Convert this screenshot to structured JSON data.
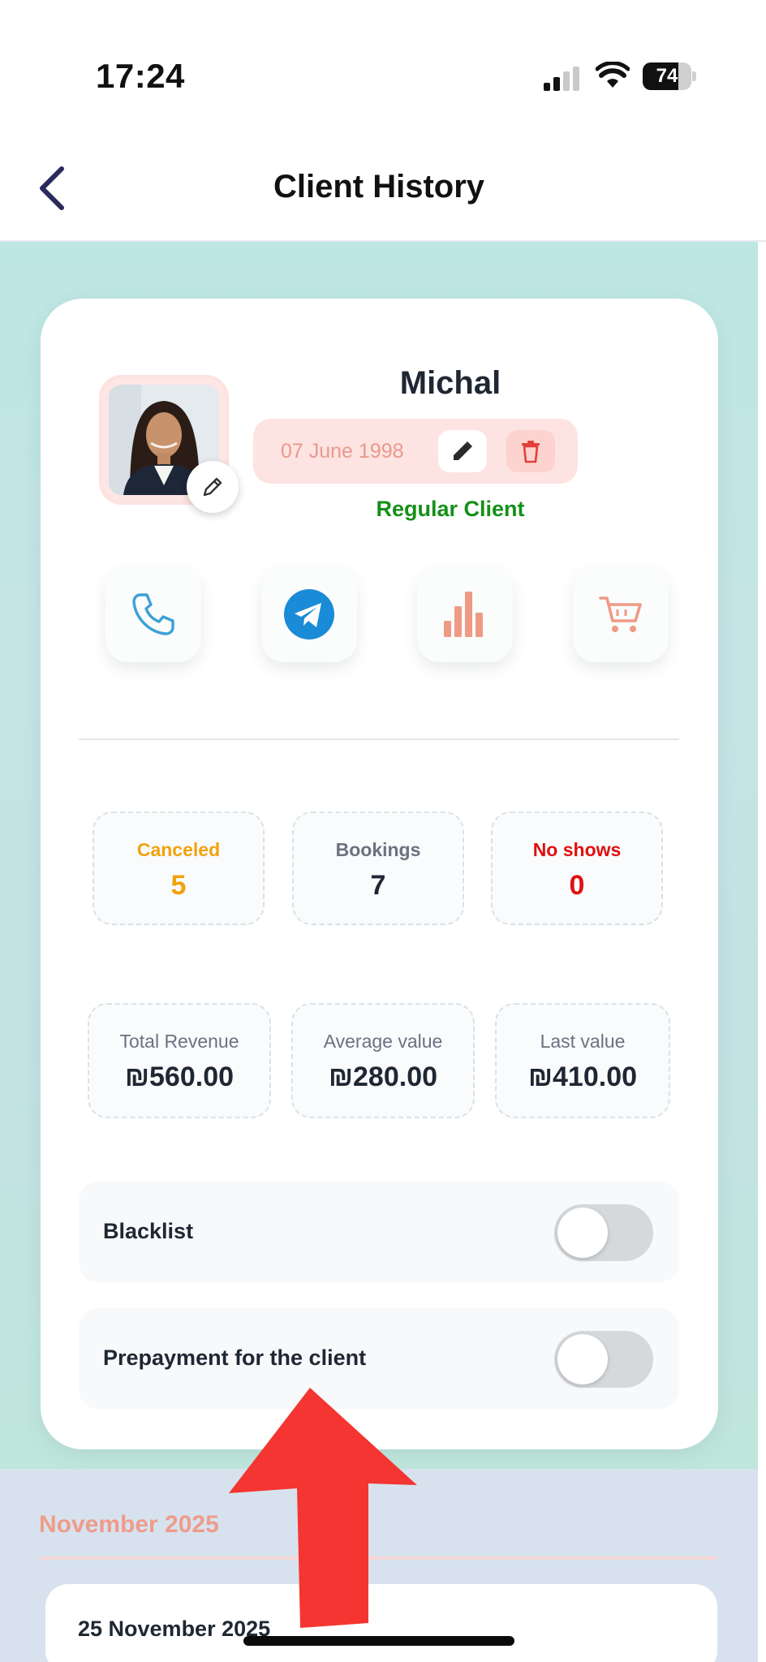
{
  "status_bar": {
    "time": "17:24",
    "battery": "74",
    "battery_level": 0.74
  },
  "nav": {
    "title": "Client History"
  },
  "client": {
    "name": "Michal",
    "birthday": "07 June 1998",
    "type": "Regular Client"
  },
  "actions": [
    {
      "icon": "phone-icon"
    },
    {
      "icon": "telegram-icon"
    },
    {
      "icon": "bar-chart-icon"
    },
    {
      "icon": "cart-icon"
    }
  ],
  "stats": [
    {
      "label": "Canceled",
      "value": "5",
      "color": "#f2a20c"
    },
    {
      "label": "Bookings",
      "value": "7",
      "color": "#1f2733"
    },
    {
      "label": "No shows",
      "value": "0",
      "color": "#e01010"
    }
  ],
  "money": [
    {
      "label": "Total Revenue",
      "value": "₪560.00"
    },
    {
      "label": "Average value",
      "value": "₪280.00"
    },
    {
      "label": "Last value",
      "value": "₪410.00"
    }
  ],
  "toggles": [
    {
      "label": "Blacklist",
      "on": false
    },
    {
      "label": "Prepayment for the client",
      "on": false
    }
  ],
  "history": {
    "month": "November 2025",
    "day": "25 November 2025"
  },
  "colors": {
    "accent_salmon": "#ee9c8c",
    "regular_green": "#149018",
    "telegram_blue": "#1a8bd6"
  }
}
